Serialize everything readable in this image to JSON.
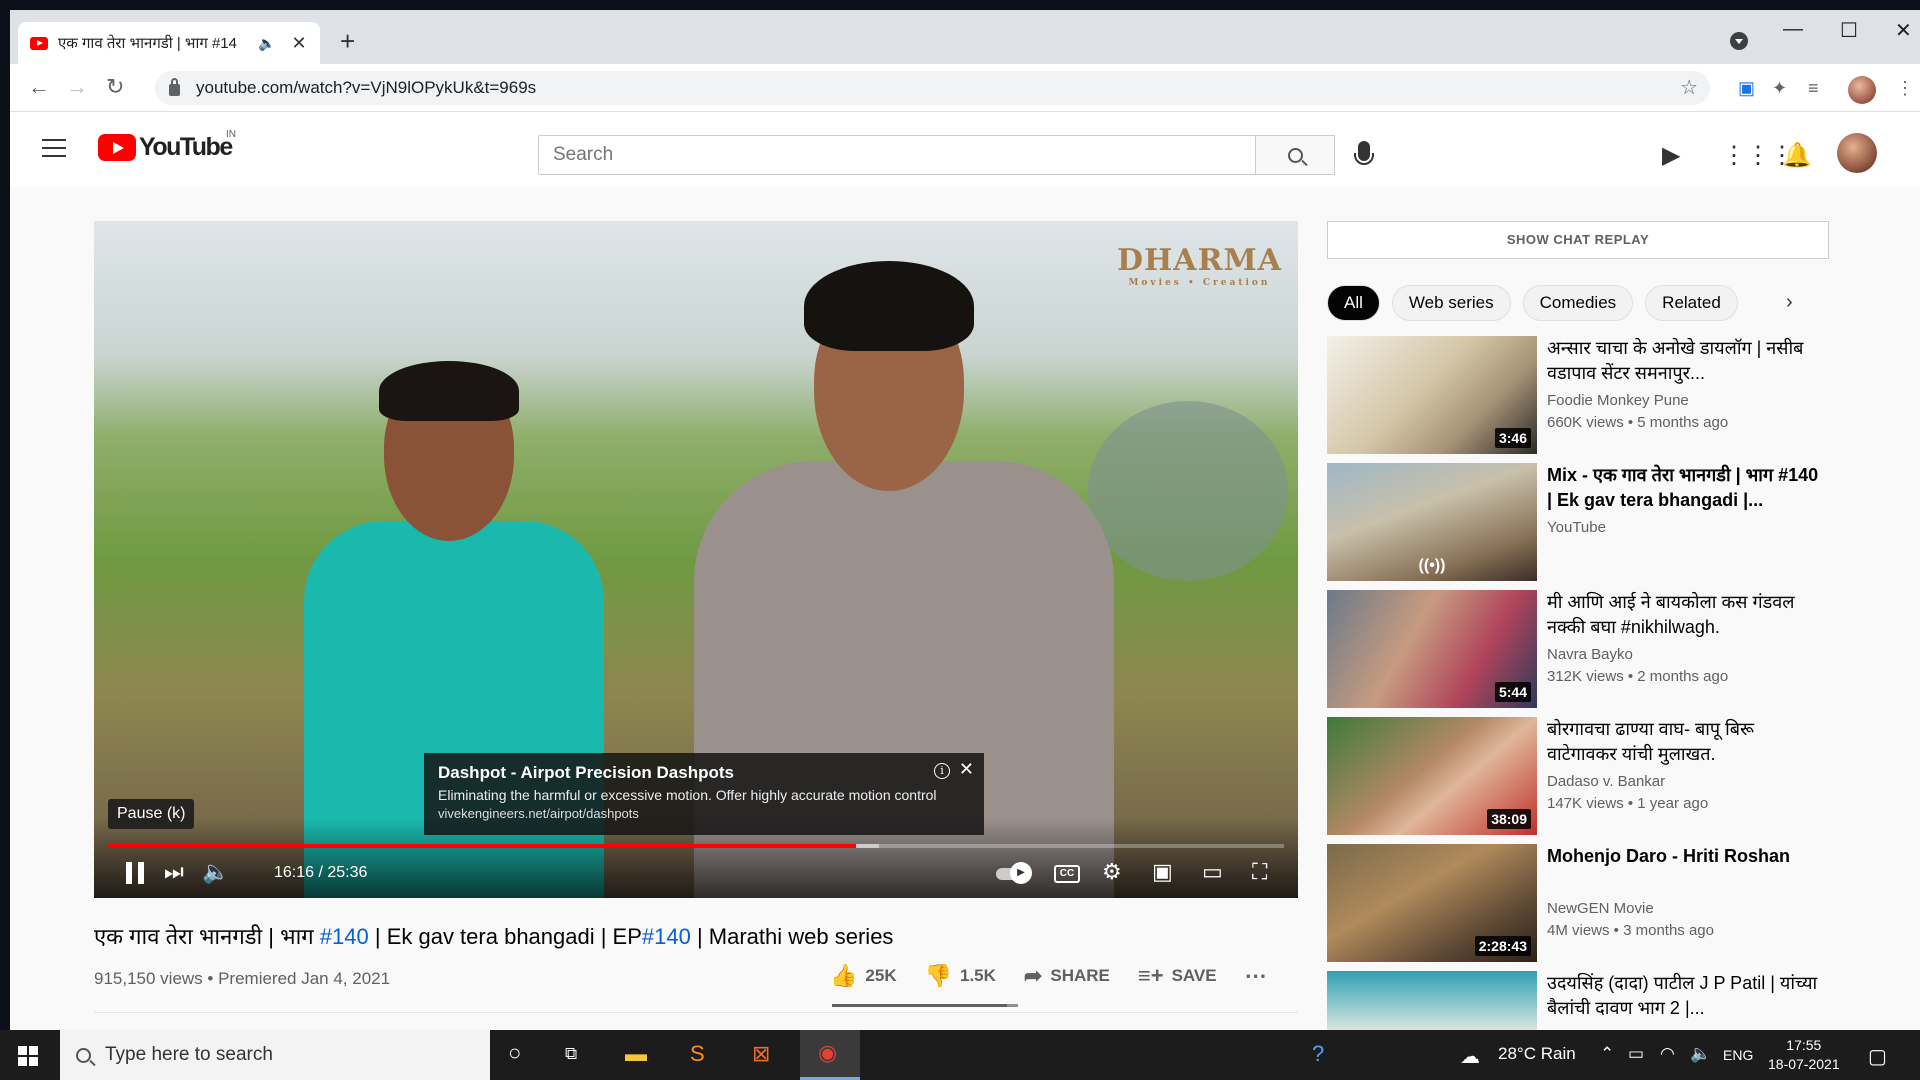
{
  "browser": {
    "tab_title": "एक गाव तेरा भानगडी | भाग #14",
    "url": "youtube.com/watch?v=VjN9lOPykUk&t=969s"
  },
  "youtube": {
    "logo_text": "YouTube",
    "region": "IN",
    "search_placeholder": "Search"
  },
  "player": {
    "watermark": "DHARMA",
    "watermark_sub": "Movies • Creation",
    "tooltip": "Pause (k)",
    "time": "16:16 / 25:36",
    "progress": 0.636,
    "buffered": 0.656,
    "ad": {
      "title": "Dashpot - Airpot Precision Dashpots",
      "desc": "Eliminating the harmful or excessive motion. Offer highly accurate motion control",
      "url": "vivekengineers.net/airpot/dashpots"
    }
  },
  "video": {
    "title_a": "एक गाव तेरा भानगडी | भाग ",
    "title_tag1": "#140",
    "title_b": " | Ek gav tera bhangadi | EP",
    "title_tag2": "#140",
    "title_c": " | Marathi web series",
    "meta": "915,150 views • Premiered Jan 4, 2021",
    "likes": "25K",
    "dislikes": "1.5K",
    "share": "SHARE",
    "save": "SAVE",
    "like_ratio": 0.94
  },
  "sidebar": {
    "chat_replay": "SHOW CHAT REPLAY",
    "chips": [
      "All",
      "Web series",
      "Comedies",
      "Related"
    ],
    "recs": [
      {
        "title": "अन्सार चाचा के अनोखे डायलॉग | नसीब वडापाव सेंटर समनापुर...",
        "channel": "Foodie Monkey Pune",
        "meta": "660K views • 5 months ago",
        "duration": "3:46"
      },
      {
        "title": "Mix - एक गाव तेरा भानगडी | भाग #140 | Ek gav tera bhangadi |...",
        "channel": "YouTube",
        "meta": "",
        "duration": ""
      },
      {
        "title": "मी आणि आई ने बायकोला कस गंडवल नक्की बघा #nikhilwagh.",
        "channel": "Navra Bayko",
        "meta": "312K views • 2 months ago",
        "duration": "5:44"
      },
      {
        "title": "बोरगावचा ढाण्या वाघ- बापू बिरू वाटेगावकर यांची मुलाखत.",
        "channel": "Dadaso v. Bankar",
        "meta": "147K views • 1 year ago",
        "duration": "38:09"
      },
      {
        "title": "Mohenjo Daro - Hriti Roshan",
        "channel": "NewGEN Movie",
        "meta": "4M views • 3 months ago",
        "duration": "2:28:43"
      },
      {
        "title": "उदयसिंह (दादा) पाटील J P Patil | यांच्या बैलांची दावण भाग 2 |...",
        "channel": "",
        "meta": "",
        "duration": ""
      }
    ]
  },
  "taskbar": {
    "search_placeholder": "Type here to search",
    "weather": "28°C  Rain",
    "lang": "ENG",
    "time": "17:55",
    "date": "18-07-2021"
  }
}
